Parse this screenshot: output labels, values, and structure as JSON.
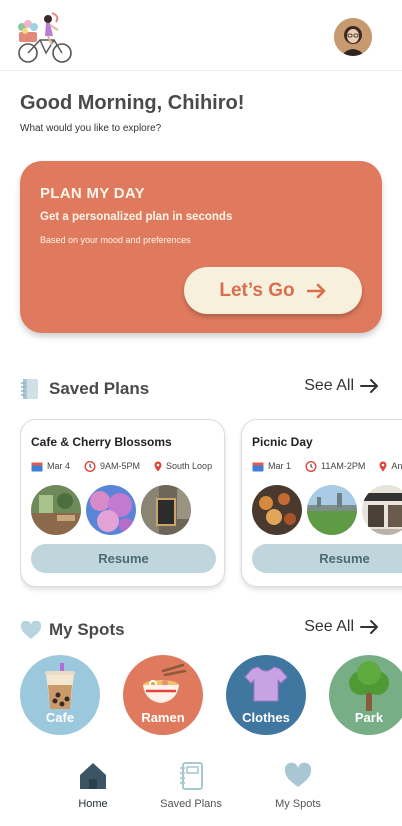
{
  "greeting": "Good Morning, Chihiro!",
  "subtitle": "What would you like to explore?",
  "plan": {
    "title": "PLAN MY DAY",
    "subtitle": "Get a personalized plan in seconds",
    "note": "Based on your mood and preferences",
    "button_label": "Let’s Go"
  },
  "saved_plans": {
    "title": "Saved Plans",
    "see_all": "See All",
    "cards": [
      {
        "title": "Cafe & Cherry Blossoms",
        "date": "Mar 4",
        "time": "9AM-5PM",
        "location": "South Loop",
        "button": "Resume"
      },
      {
        "title": "Picnic Day",
        "date": "Mar 1",
        "time": "11AM-2PM",
        "location": "And",
        "button": "Resume"
      }
    ]
  },
  "my_spots": {
    "title": "My Spots",
    "see_all": "See All",
    "items": [
      {
        "label": "Cafe",
        "color": "#9cc8de"
      },
      {
        "label": "Ramen",
        "color": "#df7a5e"
      },
      {
        "label": "Clothes",
        "color": "#3f77a0"
      },
      {
        "label": "Park",
        "color": "#78ae86"
      }
    ]
  },
  "tabs": [
    {
      "label": "Home",
      "icon": "home-icon",
      "active": true
    },
    {
      "label": "Saved Plans",
      "icon": "notebook-icon",
      "active": false
    },
    {
      "label": "My Spots",
      "icon": "heart-icon",
      "active": false
    }
  ],
  "colors": {
    "accent": "#df7a5e",
    "cream": "#f7f0dd",
    "resume": "#c0d6dd",
    "tab_active": "#3b5566",
    "tab_inactive": "#a9c7d3"
  }
}
